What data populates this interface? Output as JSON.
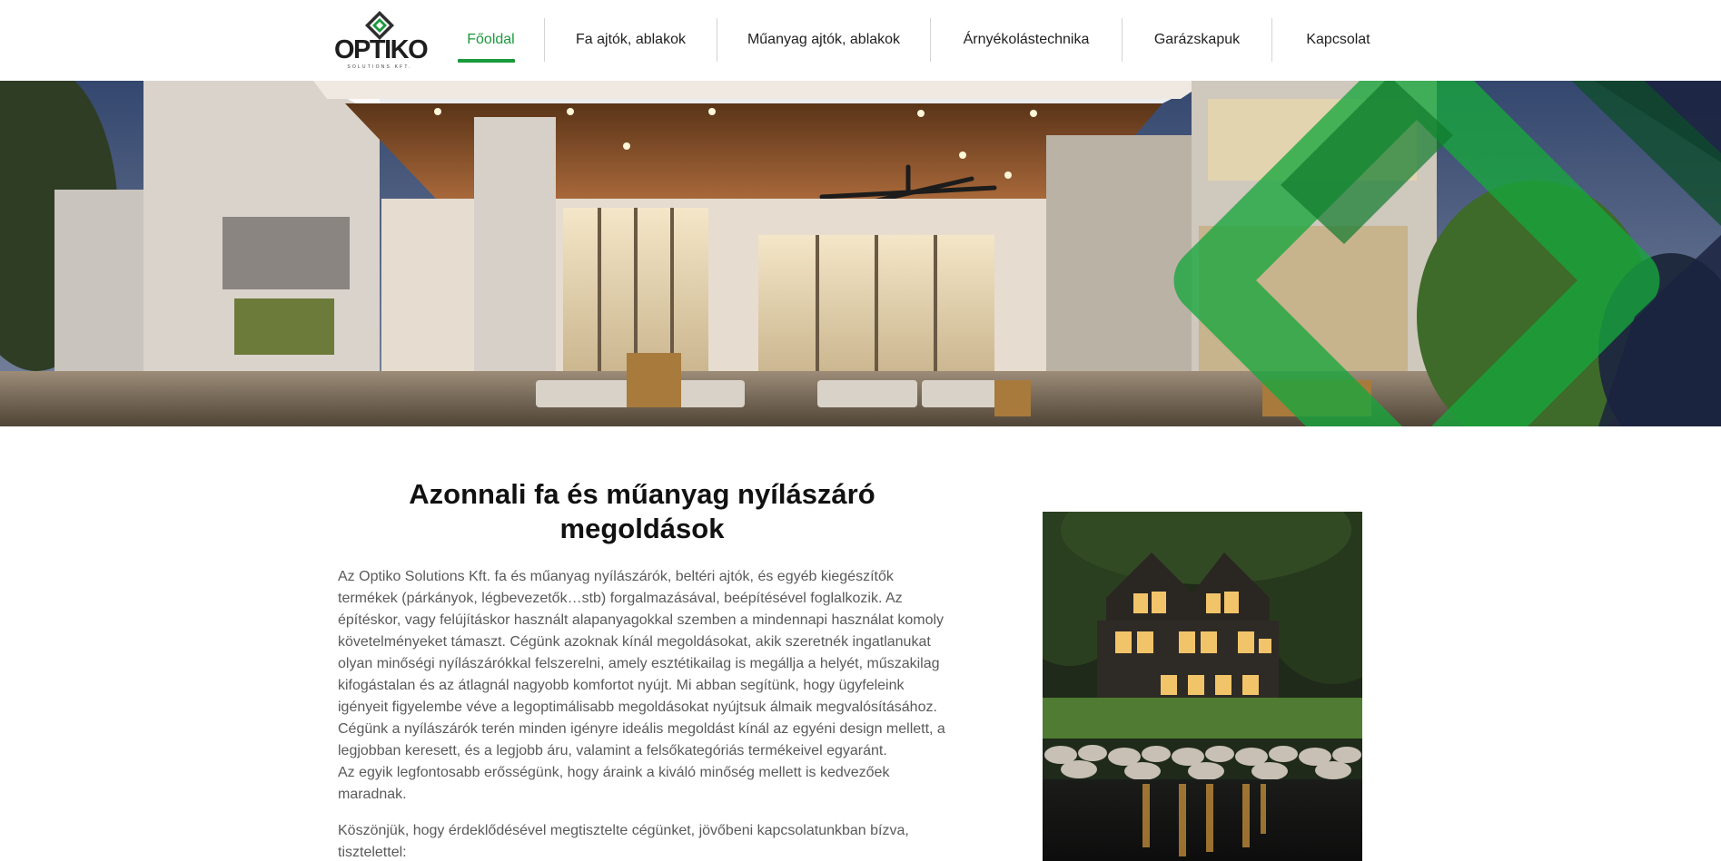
{
  "brand": {
    "name": "OPTIKO",
    "tagline": "SOLUTIONS KFT.",
    "accent_color": "#1b9a3c",
    "logo_icon": "diamond-logo-mark"
  },
  "nav": {
    "items": [
      {
        "label": "Főoldal",
        "active": true
      },
      {
        "label": "Fa ajtók, ablakok",
        "active": false
      },
      {
        "label": "Műanyag ajtók, ablakok",
        "active": false
      },
      {
        "label": "Árnyékolástechnika",
        "active": false
      },
      {
        "label": "Garázskapuk",
        "active": false
      },
      {
        "label": "Kapcsolat",
        "active": false
      }
    ]
  },
  "hero": {
    "image": "modern-house-terrace-night-photo",
    "overlay": "green-diamond-graphic"
  },
  "main": {
    "title": "Azonnali fa és műanyag nyílászáró megoldások",
    "paragraph1": "Az Optiko Solutions Kft. fa és műanyag nyílászárók, beltéri ajtók, és egyéb kiegészítők termékek (párkányok, légbevezetők…stb) forgalmazásával, beépítésével foglalkozik. Az építéskor, vagy felújításkor használt alapanyagokkal szemben a mindennapi használat komoly követelményeket támaszt. Cégünk azoknak kínál megoldásokat, akik szeretnék ingatlanukat olyan minőségi nyílászárókkal felszerelni, amely esztétikailag is megállja a helyét, műszakilag kifogástalan és az átlagnál nagyobb komfortot nyújt. Mi abban segítünk, hogy ügyfeleink igényeit figyelembe véve a legoptimálisabb megoldásokat nyújtsuk álmaik megvalósításához. Cégünk a nyílászárók terén minden igényre ideális megoldást kínál az egyéni design mellett, a legjobban keresett, és a legjobb áru, valamint a felsőkategóriás termékeivel egyaránt.",
    "paragraph2": "Az egyik legfontosabb erősségünk, hogy áraink a kiváló minőség mellett is kedvezőek maradnak.",
    "paragraph3": "Köszönjük, hogy érdeklődésével megtisztelte cégünket, jövőbeni kapcsolatunkban bízva, tisztelettel:",
    "side_image": "lakeside-house-evening-photo"
  }
}
